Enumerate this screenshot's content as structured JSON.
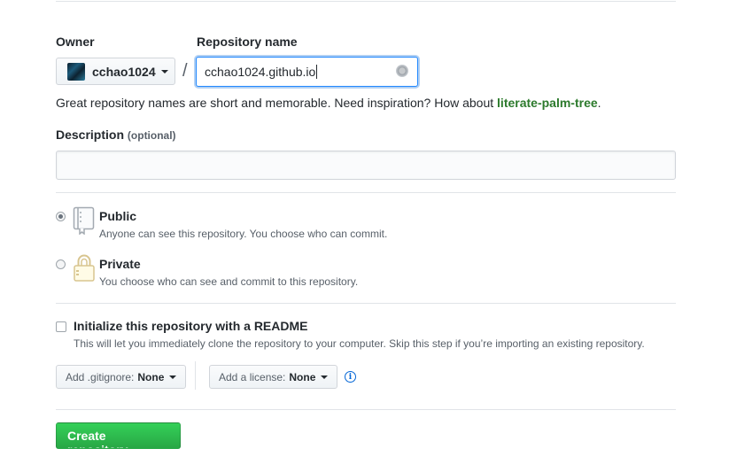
{
  "owner": {
    "label": "Owner",
    "name": "cchao1024"
  },
  "repository": {
    "label": "Repository name",
    "separator": "/",
    "value": "cchao1024.github.io"
  },
  "hint": {
    "text": "Great repository names are short and memorable. Need inspiration? How about ",
    "suggestion": "literate-palm-tree",
    "end": "."
  },
  "description": {
    "label": "Description",
    "optional": "(optional)",
    "value": ""
  },
  "visibility": {
    "selected": "public",
    "public": {
      "title": "Public",
      "note": "Anyone can see this repository. You choose who can commit."
    },
    "private": {
      "title": "Private",
      "note": "You choose who can see and commit to this repository."
    }
  },
  "readme": {
    "title": "Initialize this repository with a README",
    "note": "This will let you immediately clone the repository to your computer. Skip this step if you’re importing an existing repository.",
    "checked": false
  },
  "gitignore": {
    "label": "Add .gitignore:",
    "value": "None"
  },
  "license": {
    "label": "Add a license:",
    "value": "None"
  },
  "info_icon": {
    "glyph": "i"
  },
  "create_button": {
    "label": "Create repository"
  },
  "colors": {
    "focus_border": "#2188ff",
    "suggestion": "#2c7a2c",
    "button_green": "#28a745",
    "info_blue": "#0366d6"
  }
}
